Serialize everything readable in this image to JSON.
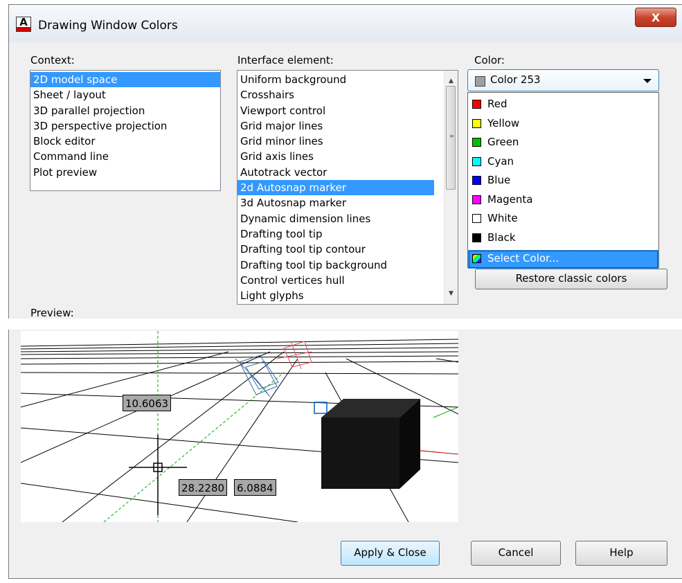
{
  "window": {
    "title": "Drawing Window Colors",
    "close_glyph": "X",
    "icon_letter": "A"
  },
  "context": {
    "label": "Context:",
    "items": [
      "2D model space",
      "Sheet / layout",
      "3D parallel projection",
      "3D perspective projection",
      "Block editor",
      "Command line",
      "Plot preview"
    ],
    "selected": "2D model space"
  },
  "interface": {
    "label": "Interface element:",
    "items": [
      "Uniform background",
      "Crosshairs",
      "Viewport control",
      "Grid major lines",
      "Grid minor lines",
      "Grid axis lines",
      "Autotrack vector",
      "2d Autosnap marker",
      "3d Autosnap marker",
      "Dynamic dimension lines",
      "Drafting tool tip",
      "Drafting tool tip contour",
      "Drafting tool tip background",
      "Control vertices hull",
      "Light glyphs"
    ],
    "selected": "2d Autosnap marker"
  },
  "color": {
    "label": "Color:",
    "selected": "Color 253",
    "selected_swatch": "#a0a0a0",
    "options": [
      {
        "label": "Red",
        "swatch": "#ff0000"
      },
      {
        "label": "Yellow",
        "swatch": "#ffff00"
      },
      {
        "label": "Green",
        "swatch": "#00c000"
      },
      {
        "label": "Cyan",
        "swatch": "#00ffff"
      },
      {
        "label": "Blue",
        "swatch": "#0000ff"
      },
      {
        "label": "Magenta",
        "swatch": "#ff00ff"
      },
      {
        "label": "White",
        "swatch": "#ffffff"
      },
      {
        "label": "Black",
        "swatch": "#000000"
      }
    ],
    "select_color": "Select Color..."
  },
  "restore_button": "Restore classic colors",
  "preview": {
    "label": "Preview:",
    "coord_distance": "10.6063",
    "coord_x": "28.2280",
    "coord_y": "6.0884"
  },
  "buttons": {
    "apply": "Apply & Close",
    "cancel": "Cancel",
    "help": "Help"
  }
}
